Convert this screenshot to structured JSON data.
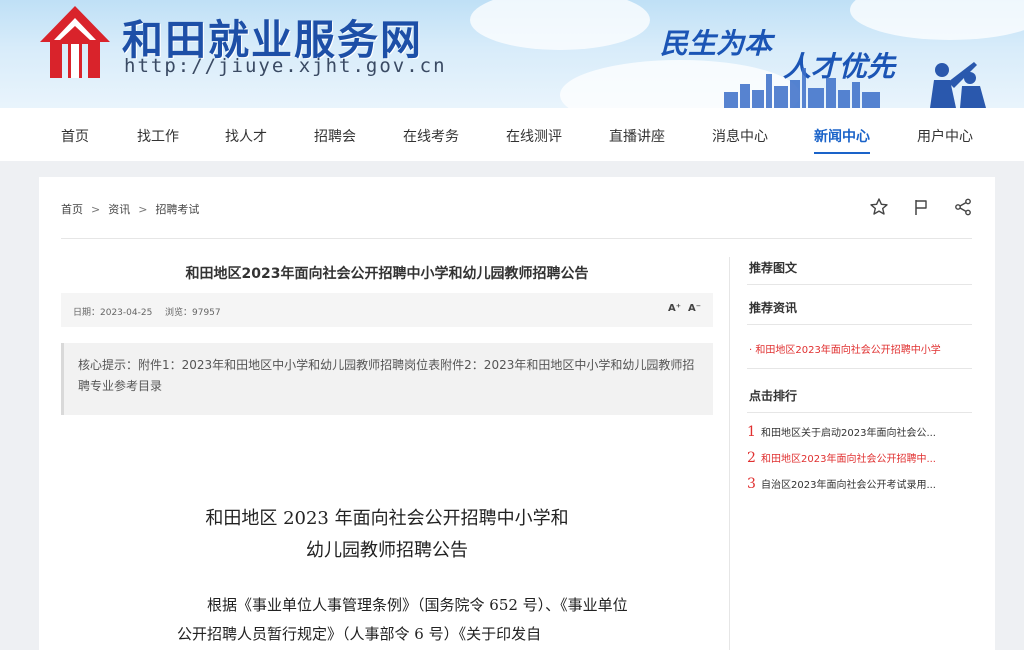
{
  "header": {
    "site_title": "和田就业服务网",
    "site_url": "http://jiuye.xjht.gov.cn",
    "slogan_1": "民生为本",
    "slogan_2": "人才优先",
    "brand_color": "#1d4fa7",
    "logo_color": "#d9232b"
  },
  "nav": {
    "items": [
      "首页",
      "找工作",
      "找人才",
      "招聘会",
      "在线考务",
      "在线测评",
      "直播讲座",
      "消息中心",
      "新闻中心",
      "用户中心"
    ],
    "active": "新闻中心",
    "active_color": "#1a63c9"
  },
  "breadcrumb": {
    "items": [
      "首页",
      "资讯",
      "招聘考试"
    ],
    "separator": ">"
  },
  "toolbar": {
    "icons": [
      "star-icon",
      "flag-icon",
      "share-icon"
    ]
  },
  "article": {
    "title": "和田地区2023年面向社会公开招聘中小学和幼儿园教师招聘公告",
    "date_label": "日期：2023-04-25",
    "views_label": "浏览：97957",
    "font_increase": "A⁺",
    "font_decrease": "A⁻",
    "summary": "核心提示：附件1：2023年和田地区中小学和幼儿园教师招聘岗位表附件2：2023年和田地区中小学和幼儿园教师招聘专业参考目录",
    "doc_title_line1": "和田地区 2023 年面向社会公开招聘中小学和",
    "doc_title_line2": "幼儿园教师招聘公告",
    "paragraph": "根据《事业单位人事管理条例》（国务院令 652 号）、《事业单位公开招聘人员暂行规定》（人事部令 6 号）《关于印发自"
  },
  "sidebar": {
    "recommended_images_heading": "推荐图文",
    "recommended_news_heading": "推荐资讯",
    "recommended_news": [
      {
        "text": "· 和田地区2023年面向社会公开招聘中小学"
      }
    ],
    "ranking_heading": "点击排行",
    "ranking": [
      {
        "num": "1",
        "text": "和田地区关于启动2023年面向社会公..."
      },
      {
        "num": "2",
        "text": "和田地区2023年面向社会公开招聘中..."
      },
      {
        "num": "3",
        "text": "自治区2023年面向社会公开考试录用..."
      }
    ],
    "highlight_color": "#e03030"
  }
}
